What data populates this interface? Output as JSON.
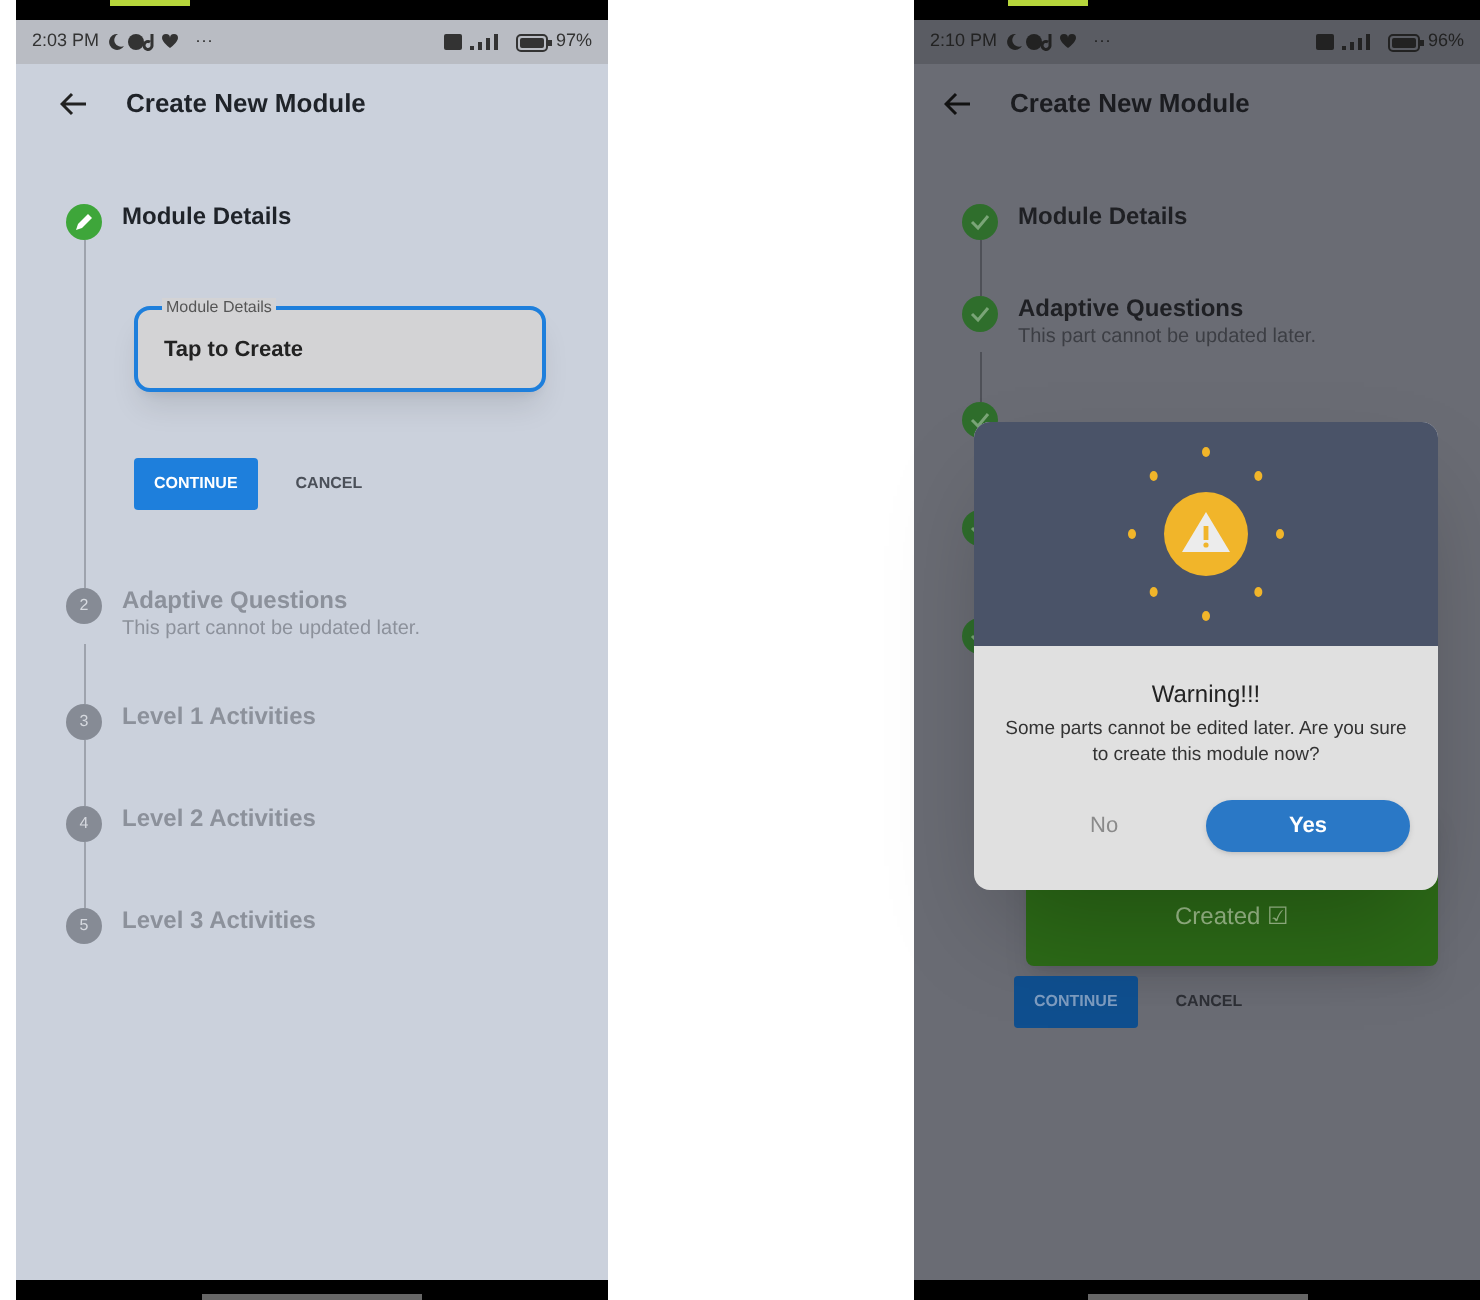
{
  "screens": [
    {
      "status_bar": {
        "time": "2:03 PM",
        "more": "···",
        "battery": "97%"
      },
      "header": {
        "title": "Create New Module"
      },
      "steps": [
        {
          "kind": "editing",
          "label": "Module Details"
        },
        {
          "kind": "pending",
          "number": "2",
          "label": "Adaptive Questions",
          "subtitle": "This part cannot be updated later."
        },
        {
          "kind": "pending",
          "number": "3",
          "label": "Level 1 Activities"
        },
        {
          "kind": "pending",
          "number": "4",
          "label": "Level 2 Activities"
        },
        {
          "kind": "pending",
          "number": "5",
          "label": "Level 3 Activities"
        }
      ],
      "field": {
        "label": "Module Details",
        "value": "Tap to Create"
      },
      "buttons": {
        "continue": "CONTINUE",
        "cancel": "CANCEL"
      }
    },
    {
      "status_bar": {
        "time": "2:10 PM",
        "more": "···",
        "battery": "96%"
      },
      "header": {
        "title": "Create New Module"
      },
      "steps": [
        {
          "kind": "done",
          "label": "Module Details"
        },
        {
          "kind": "done",
          "label": "Adaptive Questions",
          "subtitle": "This part cannot be updated later."
        },
        {
          "kind": "done"
        },
        {
          "kind": "done"
        },
        {
          "kind": "done"
        }
      ],
      "created_card": {
        "text": "Created ☑"
      },
      "buttons": {
        "continue": "CONTINUE",
        "cancel": "CANCEL"
      },
      "dialog": {
        "title": "Warning!!!",
        "message": "Some parts cannot be edited later. Are you sure to create this module now?",
        "buttons": [
          "No",
          "Yes"
        ]
      }
    }
  ]
}
